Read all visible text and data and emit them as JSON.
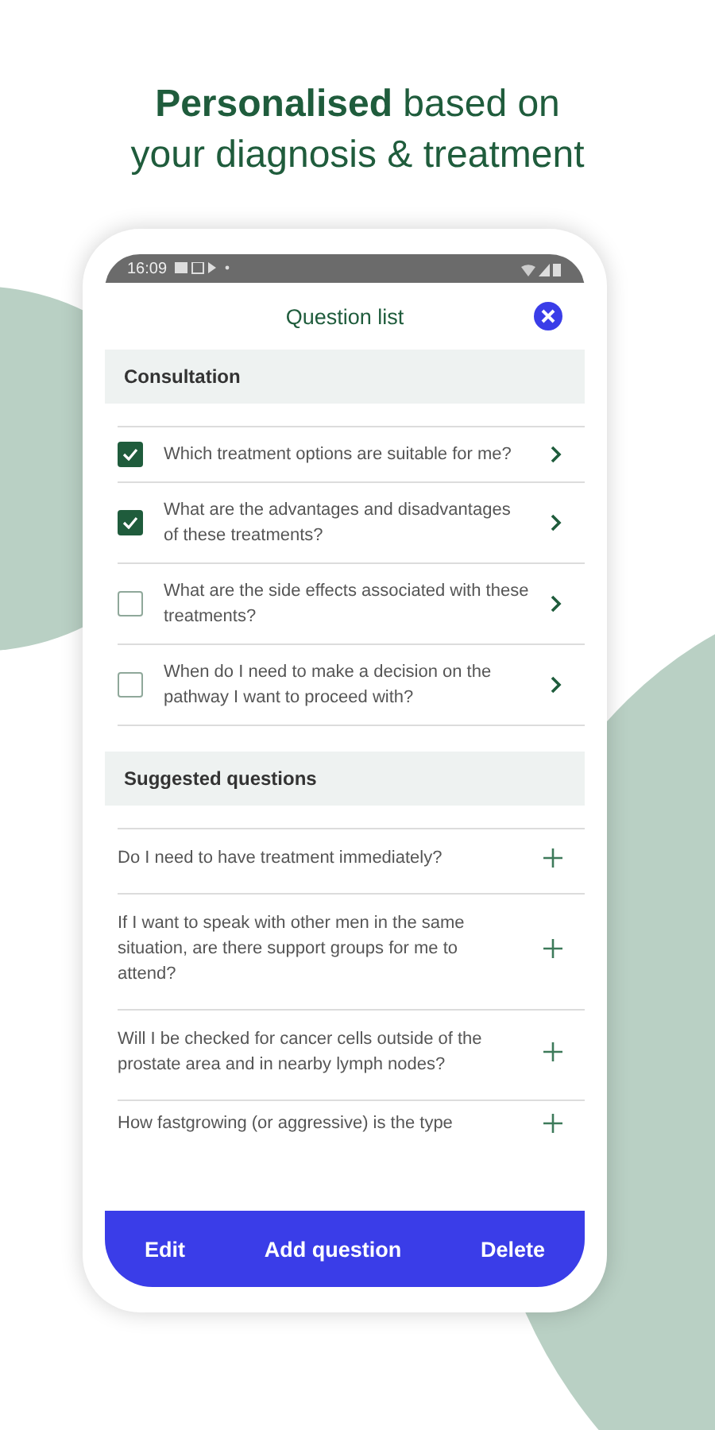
{
  "headline": [
    "**Personalised** based on",
    "your diagnosis & treatment"
  ],
  "status_bar": {
    "time": "16:09"
  },
  "header": {
    "title": "Question list"
  },
  "sections": [
    {
      "title": "Consultation",
      "kind": "checklist",
      "items": [
        {
          "text": "Which treatment options are suitable for me?",
          "checked": true
        },
        {
          "text": "What are the advantages and disadvantages of these treatments?",
          "checked": true
        },
        {
          "text": "What are the side effects associated with these treatments?",
          "checked": false
        },
        {
          "text": "When do I need to make a decision on the pathway I want to proceed with?",
          "checked": false
        }
      ]
    },
    {
      "title": "Suggested questions",
      "kind": "suggestions",
      "items": [
        {
          "text": "Do I need to have treatment immediately?"
        },
        {
          "text": "If I want to speak with other men in the same situation, are there support groups for me to attend?"
        },
        {
          "text": "Will I be checked for cancer cells outside of the prostate area and in nearby lymph nodes?"
        },
        {
          "text": "How fastgrowing (or aggressive) is the type"
        }
      ]
    }
  ],
  "actions": [
    "Edit",
    "Add question",
    "Delete"
  ]
}
